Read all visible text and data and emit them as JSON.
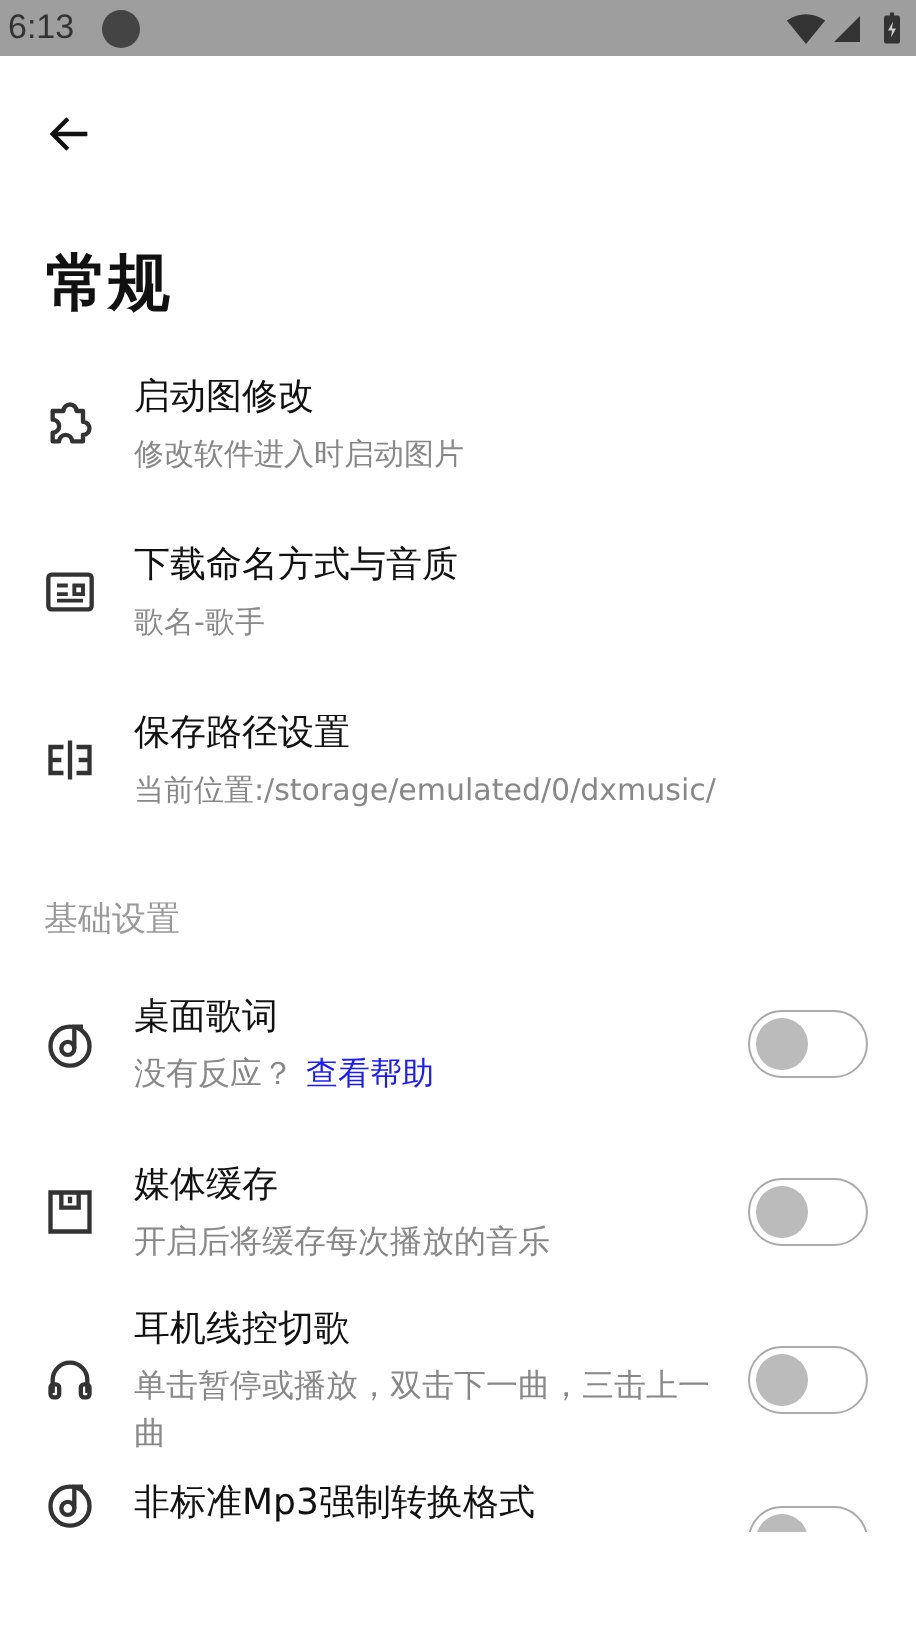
{
  "status_bar": {
    "time": "6:13"
  },
  "page": {
    "title": "常规"
  },
  "general_items": [
    {
      "title": "启动图修改",
      "subtitle": "修改软件进入时启动图片"
    },
    {
      "title": "下载命名方式与音质",
      "subtitle": "歌名-歌手"
    },
    {
      "title": "保存路径设置",
      "subtitle": "当前位置:/storage/emulated/0/dxmusic/"
    }
  ],
  "section": {
    "title": "基础设置"
  },
  "switch_items": [
    {
      "title": "桌面歌词",
      "subtitle": "没有反应？",
      "link": "查看帮助",
      "on": false
    },
    {
      "title": "媒体缓存",
      "subtitle": "开启后将缓存每次播放的音乐",
      "on": false
    },
    {
      "title": "耳机线控切歌",
      "subtitle": "单击暂停或播放，双击下一曲，三击上一曲",
      "on": false
    },
    {
      "title": "非标准Mp3强制转换格式",
      "on": false
    }
  ]
}
